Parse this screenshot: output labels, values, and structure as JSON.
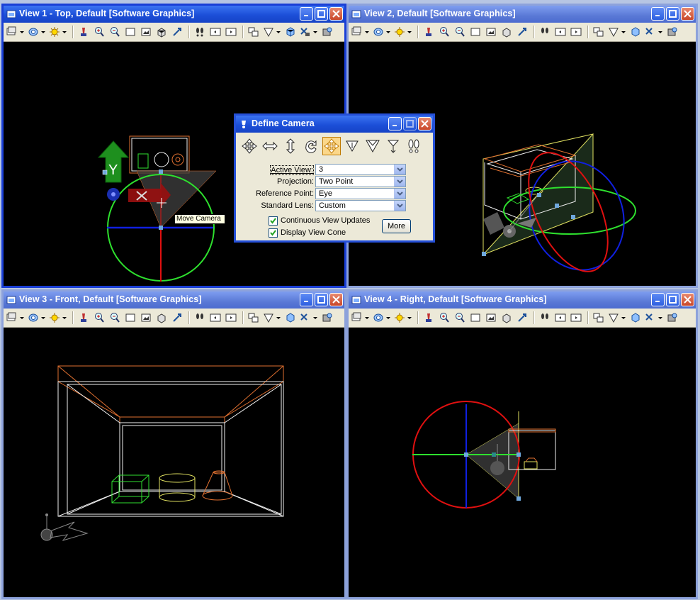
{
  "views": [
    {
      "title": "View 1 - Top, Default [Software Graphics]"
    },
    {
      "title": "View 2, Default [Software Graphics]"
    },
    {
      "title": "View 3 - Front, Default [Software Graphics]"
    },
    {
      "title": "View 4 - Right, Default [Software Graphics]"
    }
  ],
  "tooltip": "Move Camera",
  "gizmo_label": "Y",
  "dialog": {
    "title": "Define Camera",
    "fields": [
      {
        "label": "Active View:",
        "value": "3"
      },
      {
        "label": "Projection:",
        "value": "Two Point"
      },
      {
        "label": "Reference Point:",
        "value": "Eye"
      },
      {
        "label": "Standard Lens:",
        "value": "Custom"
      }
    ],
    "checks": [
      {
        "label": "Continuous View Updates",
        "checked": true
      },
      {
        "label": "Display View Cone",
        "checked": true
      }
    ],
    "more_label": "More"
  },
  "colors": {
    "title_active": "#1c4fd8",
    "title_inactive": "#6f8de0",
    "axis_red": "#e01010",
    "axis_green": "#2ee02e",
    "axis_blue": "#1020e0",
    "room_orange": "#e07030",
    "cube_green": "#30e030",
    "cylinder_yellow": "#e0e060"
  }
}
